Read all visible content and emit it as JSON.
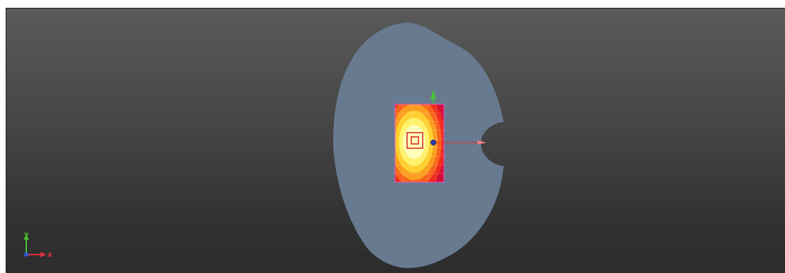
{
  "viewport": {
    "background_top": "#5a5a5a",
    "background_bottom": "#2c2c2c"
  },
  "model": {
    "region_color": "#687a8f",
    "hole_color": "#3a3a3a",
    "plate_palette": [
      "#d0103a",
      "#ef2a1f",
      "#f8631a",
      "#fb9d1e",
      "#ffcf2e",
      "#fff16a",
      "#ffffb8"
    ]
  },
  "triad": {
    "x_label": "x",
    "y_label": "y",
    "x_color": "#e0303a",
    "y_color": "#49c233",
    "z_color": "#2b5fd9"
  },
  "icons": {
    "global_triad": "xyz-triad-icon",
    "local_y_arrow": "green-arrow-icon",
    "local_x_arrow": "red-arrow-icon",
    "origin_point": "blue-dot-icon"
  }
}
